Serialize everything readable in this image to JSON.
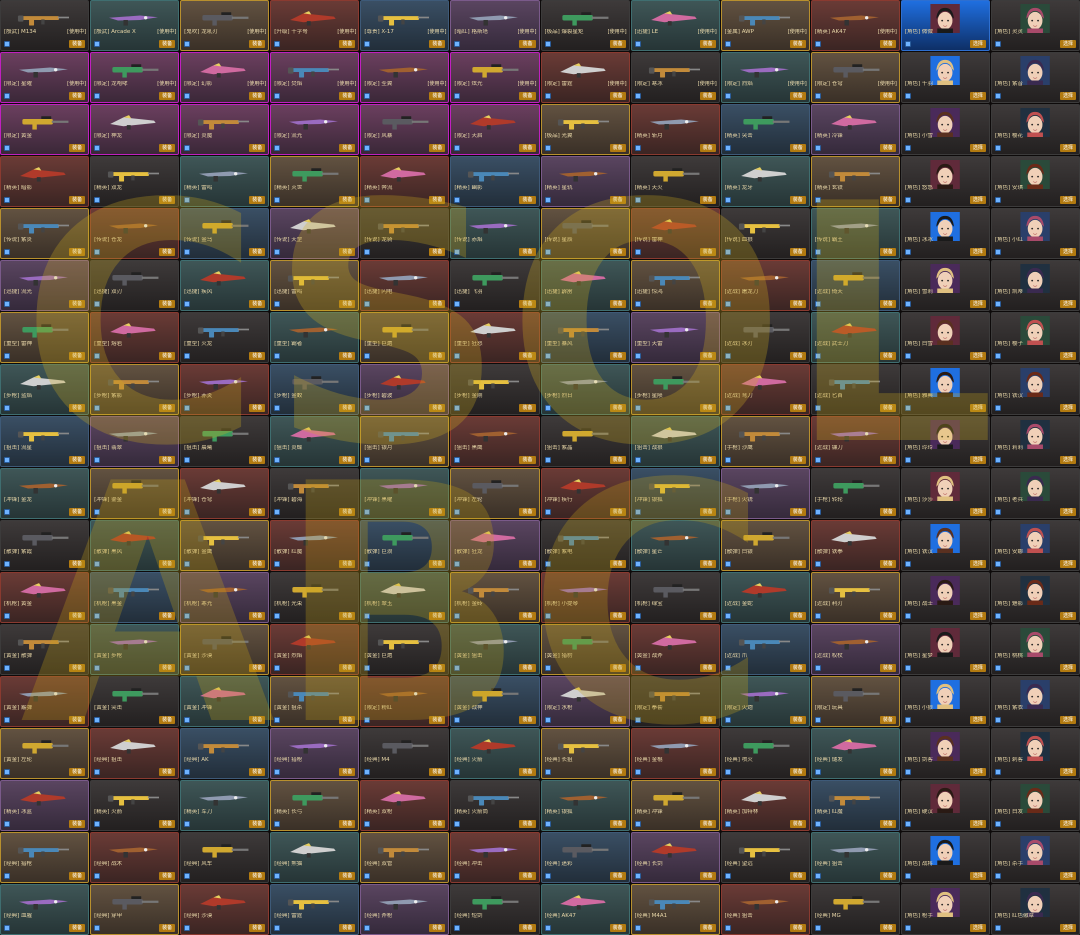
{
  "labels": {
    "use": "[使用中]",
    "equip": "装备",
    "select": "选择"
  },
  "watermark": {
    "brand": "CSOL",
    "tag": "ABC"
  },
  "colors": {
    "frame_magenta": "#c020c0",
    "frame_gold": "#b8902e",
    "equip_button": "#b27a10",
    "lock_icon": "#6fb3ff",
    "name_text": "#e8d7a8"
  },
  "rows": [
    [
      "[殷武] M134",
      "[殷武] Arcade X",
      "[鬼吹] 龙吼刃",
      "[升级] 十字弩",
      "[尊贵] X-17",
      "[暗红] 格斯塔",
      "[极品] 爆裂星矩",
      "[迅捷] LE",
      "[金属] AWP",
      "[精英] AK47",
      "[角色] 微微",
      "[角色] 灵灵"
    ],
    [
      "[限定] 星曜",
      "[限定] 龙咆哮",
      "[限定] 幻影",
      "[限定] 焚焰",
      "[限定] 圣翼",
      "[限定] 炫光",
      "[限定] 雷霆",
      "[限定] 寒冰",
      "[限定] 烈焰",
      "[限定] 苍穹",
      "[角色] 千羽",
      "[角色] 紫音"
    ],
    [
      "[限定] 黄金",
      "[限定] 神龙",
      "[限定] 炎魔",
      "[限定] 流光",
      "[限定] 风暴",
      "[限定] 天启",
      "[极品] 光翼",
      "[精英] 斩月",
      "[精英] 突击",
      "[精英] 冷锋",
      "[角色] 小雪",
      "[角色] 樱花"
    ],
    [
      "[精英] 暗影",
      "[精英] 双龙",
      "[精英] 雷鸣",
      "[精英] 灭世",
      "[精英] 奔流",
      "[精英] 幽影",
      "[精英] 星轨",
      "[精英] 天火",
      "[精英] 龙牙",
      "[精英] 玄铁",
      "[角色] 悠悠",
      "[角色] 安琪"
    ],
    [
      "[传说] 紫炎",
      "[传说] 苍龙",
      "[传说] 金乌",
      "[传说] 天罡",
      "[传说] 龙骑",
      "[传说] 赤焰",
      "[传说] 星辰",
      "[传说] 雷神",
      "[传说] 血狼",
      "[传说] 霸王",
      "[角色] 冰冰",
      "[角色] 小红"
    ],
    [
      "[迅捷] 流光",
      "[迅捷] 双刃",
      "[迅捷] 疾风",
      "[迅捷] 雷鸣",
      "[迅捷] 闪电",
      "[迅捷] 飞羽",
      "[迅捷] 霹雳",
      "[迅捷] 惊鸿",
      "[近战] 屠龙刀",
      "[近战] 倚天",
      "[角色] 雪莉",
      "[角色] 凯蒂"
    ],
    [
      "[重型] 雷神",
      "[重型] 熔岩",
      "[重型] 火龙",
      "[重型] 霸者",
      "[重型] 巨炮",
      "[重型] 狂怒",
      "[重型] 暴风",
      "[重型] 天雷",
      "[近战] 冰刃",
      "[近战] 武士刀",
      "[角色] 白雪",
      "[角色] 樱子"
    ],
    [
      "[步枪] 蓝焰",
      "[步枪] 紫影",
      "[步枪] 赤炎",
      "[步枪] 金蛟",
      "[步枪] 碧波",
      "[步枪] 金刚",
      "[步枪] 烈日",
      "[步枪] 星陨",
      "[近战] 弯刀",
      "[近战] 匕首",
      "[角色] 雅典",
      "[角色] 铁汉"
    ],
    [
      "[狙击] 流星",
      "[狙击] 翡翠",
      "[狙击] 晨曦",
      "[狙击] 炎蝶",
      "[狙击] 银月",
      "[狙击] 黑鹰",
      "[狙击] 紫晶",
      "[狙击] 战狼",
      "[手枪] 沙鹰",
      "[近战] 镰刀",
      "[角色] 玲玲",
      "[角色] 莉莉"
    ],
    [
      "[冲锋] 金龙",
      "[冲锋] 鎏金",
      "[冲锋] 苍穹",
      "[冲锋] 碧海",
      "[冲锋] 黑曜",
      "[冲锋] 左轮",
      "[冲锋] 疾行",
      "[冲锋] 银狐",
      "[手枪] 火铳",
      "[手枪] 转轮",
      "[角色] 莎莎",
      "[角色] 老兵"
    ],
    [
      "[散弹] 紫霞",
      "[散弹] 黑风",
      "[散弹] 金鹰",
      "[散弹] 红魔",
      "[散弹] 巨浪",
      "[散弹] 狂龙",
      "[散弹] 紫电",
      "[散弹] 星芒",
      "[散弹] 白银",
      "[散弹] 铁拳",
      "[角色] 铁汉",
      "[角色] 安娜"
    ],
    [
      "[机枪] 黄金",
      "[机枪] 黑金",
      "[机枪] 寒光",
      "[机枪] 光束",
      "[机枪] 翠玉",
      "[机枪] 金砖",
      "[机枪] 小提琴",
      "[机枪] 绿宝",
      "[近战] 金蛇",
      "[近战] 利刃",
      "[角色] 战士",
      "[角色] 魅影"
    ],
    [
      "[黄金] 散弹",
      "[黄金] 步枪",
      "[黄金] 沙漠",
      "[黄金] 烈焰",
      "[黄金] 巨炮",
      "[黄金] 狙击",
      "[黄金] 猎豹",
      "[黄金] 战斧",
      "[近战] 爪",
      "[近战] 权杖",
      "[角色] 星梦",
      "[角色] 桃桃"
    ],
    [
      "[黄金] 霰弹",
      "[黄金] 突击",
      "[黄金] 冲锋",
      "[黄金] 狙杀",
      "[限定] 粉红",
      "[黄金] 战神",
      "[限定] 水枪",
      "[限定] 拳套",
      "[限定] 火炮",
      "[限定] 玩具",
      "[角色] 小狼",
      "[角色] 紫衣"
    ],
    [
      "[黄金] 左轮",
      "[经典] 狙击",
      "[经典] AK",
      "[经典] 猎枪",
      "[经典] M4",
      "[经典] 火箭",
      "[经典] 长狙",
      "[经典] 金棍",
      "[经典] 喷火",
      "[经典] 燧发",
      "[角色] 剑客",
      "[角色] 刺客"
    ],
    [
      "[精英] 冰蓝",
      "[精英] 火箭",
      "[精英] 军刀",
      "[精英] 长弓",
      "[精英] 双枪",
      "[精英] 火箭筒",
      "[精英] 银狐",
      "[精英] 冲锋",
      "[精英] 加特林",
      "[精英] 红魔",
      "[角色] 硬汉",
      "[角色] 白发"
    ],
    [
      "[经典] 猎枪",
      "[经典] 战术",
      "[经典] 风车",
      "[经典] 熊猫",
      "[经典] 双管",
      "[经典] 冲击",
      "[经典] 迷彩",
      "[经典] 长剑",
      "[经典] 望远",
      "[经典] 狙击",
      "[角色] 战将",
      "[角色] 杀手"
    ],
    [
      "[经典] 血腥",
      "[经典] 穿甲",
      "[经典] 沙漠",
      "[经典] 雷霆",
      "[经典] 斧枪",
      "[经典] 短剑",
      "[经典] AK47",
      "[经典] M4A1",
      "[经典] 狙击",
      "[经典] MG",
      "[角色] 枪手",
      "[角色] 红色徽章"
    ]
  ]
}
